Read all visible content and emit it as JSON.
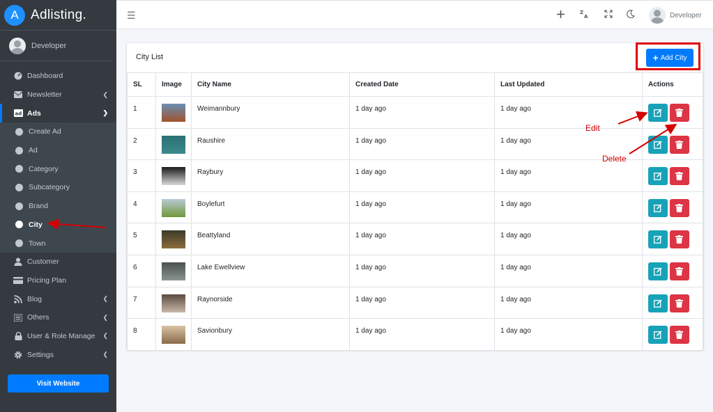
{
  "brand": {
    "logo_letter": "A",
    "name": "Adlisting."
  },
  "sidebar": {
    "user_name": "Developer",
    "items": [
      {
        "label": "Dashboard",
        "icon": "dashboard-icon"
      },
      {
        "label": "Newsletter",
        "icon": "envelope-icon",
        "has_children": true
      },
      {
        "label": "Ads",
        "icon": "ad-icon",
        "open": true,
        "children": [
          {
            "label": "Create Ad"
          },
          {
            "label": "Ad"
          },
          {
            "label": "Category"
          },
          {
            "label": "Subcategory"
          },
          {
            "label": "Brand"
          },
          {
            "label": "City",
            "active": true
          },
          {
            "label": "Town"
          }
        ]
      },
      {
        "label": "Customer",
        "icon": "user-icon"
      },
      {
        "label": "Pricing Plan",
        "icon": "credit-card-icon"
      },
      {
        "label": "Blog",
        "icon": "blog-icon",
        "has_children": true
      },
      {
        "label": "Others",
        "icon": "list-icon",
        "has_children": true
      },
      {
        "label": "User & Role Manage",
        "icon": "lock-icon",
        "has_children": true
      },
      {
        "label": "Settings",
        "icon": "gear-icon",
        "has_children": true
      }
    ],
    "visit_button": "Visit Website"
  },
  "topbar": {
    "user_name": "Developer",
    "language_icon_text": "ZA"
  },
  "card": {
    "title": "City List",
    "add_button": "Add City",
    "columns": [
      "SL",
      "Image",
      "City Name",
      "Created Date",
      "Last Updated",
      "Actions"
    ],
    "rows": [
      {
        "sl": "1",
        "name": "Weimannbury",
        "created": "1 day ago",
        "updated": "1 day ago",
        "thumb_colors": [
          "#6b8fb3",
          "#a0522d"
        ]
      },
      {
        "sl": "2",
        "name": "Raushire",
        "created": "1 day ago",
        "updated": "1 day ago",
        "thumb_colors": [
          "#2a6f73",
          "#3d8a8e"
        ]
      },
      {
        "sl": "3",
        "name": "Raybury",
        "created": "1 day ago",
        "updated": "1 day ago",
        "thumb_colors": [
          "#1a1a1a",
          "#d8d8d8"
        ]
      },
      {
        "sl": "4",
        "name": "Boylefurt",
        "created": "1 day ago",
        "updated": "1 day ago",
        "thumb_colors": [
          "#b9c9d6",
          "#6e9a3a"
        ]
      },
      {
        "sl": "5",
        "name": "Beattyland",
        "created": "1 day ago",
        "updated": "1 day ago",
        "thumb_colors": [
          "#3b3a2a",
          "#8a6d3b"
        ]
      },
      {
        "sl": "6",
        "name": "Lake Ewellview",
        "created": "1 day ago",
        "updated": "1 day ago",
        "thumb_colors": [
          "#4a5250",
          "#8a9490"
        ]
      },
      {
        "sl": "7",
        "name": "Raynorside",
        "created": "1 day ago",
        "updated": "1 day ago",
        "thumb_colors": [
          "#5a4a40",
          "#c9b8a8"
        ]
      },
      {
        "sl": "8",
        "name": "Savionbury",
        "created": "1 day ago",
        "updated": "1 day ago",
        "thumb_colors": [
          "#d9c3a5",
          "#8a6a4a"
        ]
      }
    ]
  },
  "annotations": {
    "edit": "Edit",
    "delete": "Delete"
  },
  "colors": {
    "primary": "#007bff",
    "info": "#17a2b8",
    "danger": "#dc3545",
    "sidebar": "#343a40",
    "annotation": "#d40000"
  }
}
